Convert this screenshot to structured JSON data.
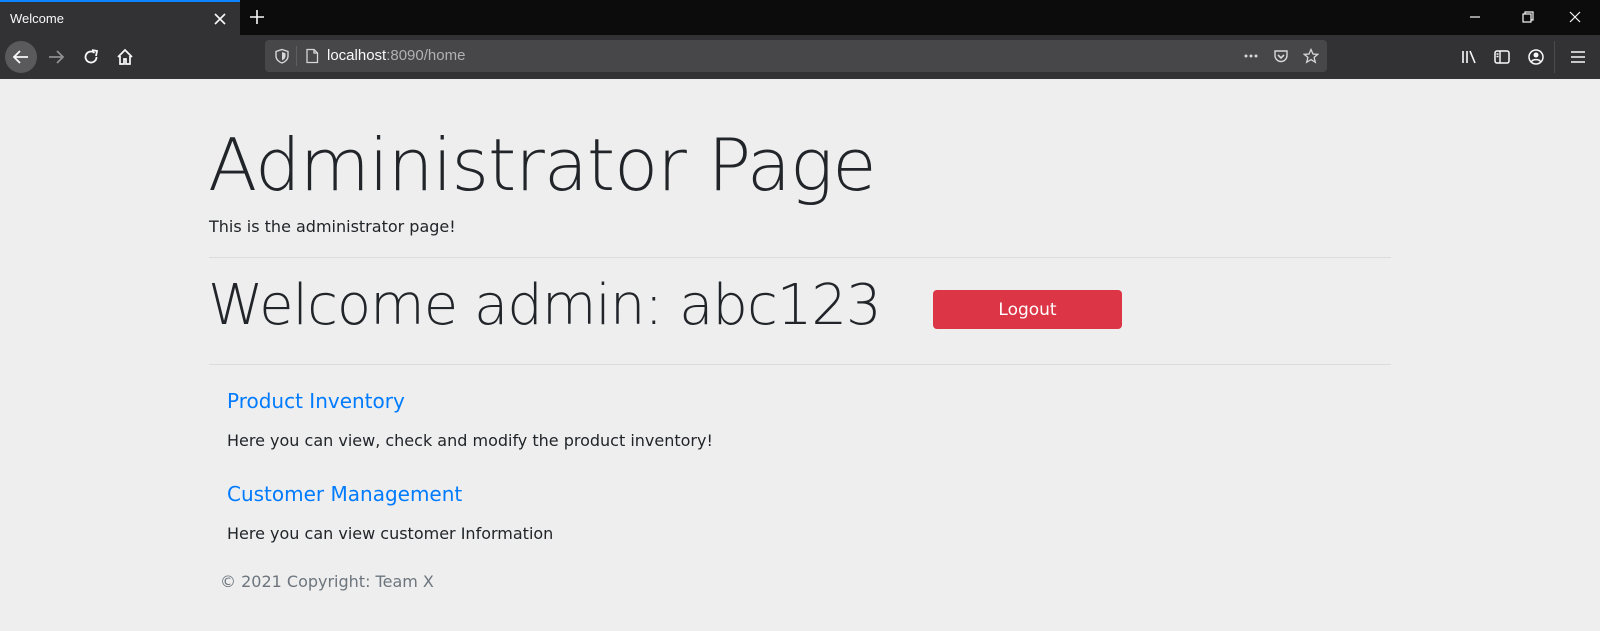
{
  "browser": {
    "tab_title": "Welcome",
    "url_host": "localhost",
    "url_rest": ":8090/home"
  },
  "page": {
    "title": "Administrator Page",
    "subtitle": "This is the administrator page!",
    "welcome": "Welcome admin: abc123",
    "logout_label": "Logout",
    "sections": [
      {
        "title": "Product Inventory",
        "text": "Here you can view, check and modify the product inventory!"
      },
      {
        "title": "Customer Management",
        "text": "Here you can view customer Information"
      }
    ],
    "footer": "© 2021 Copyright: Team X"
  },
  "colors": {
    "logout": "#dc3545",
    "link": "#007bff",
    "tab_accent": "#0a84ff"
  }
}
